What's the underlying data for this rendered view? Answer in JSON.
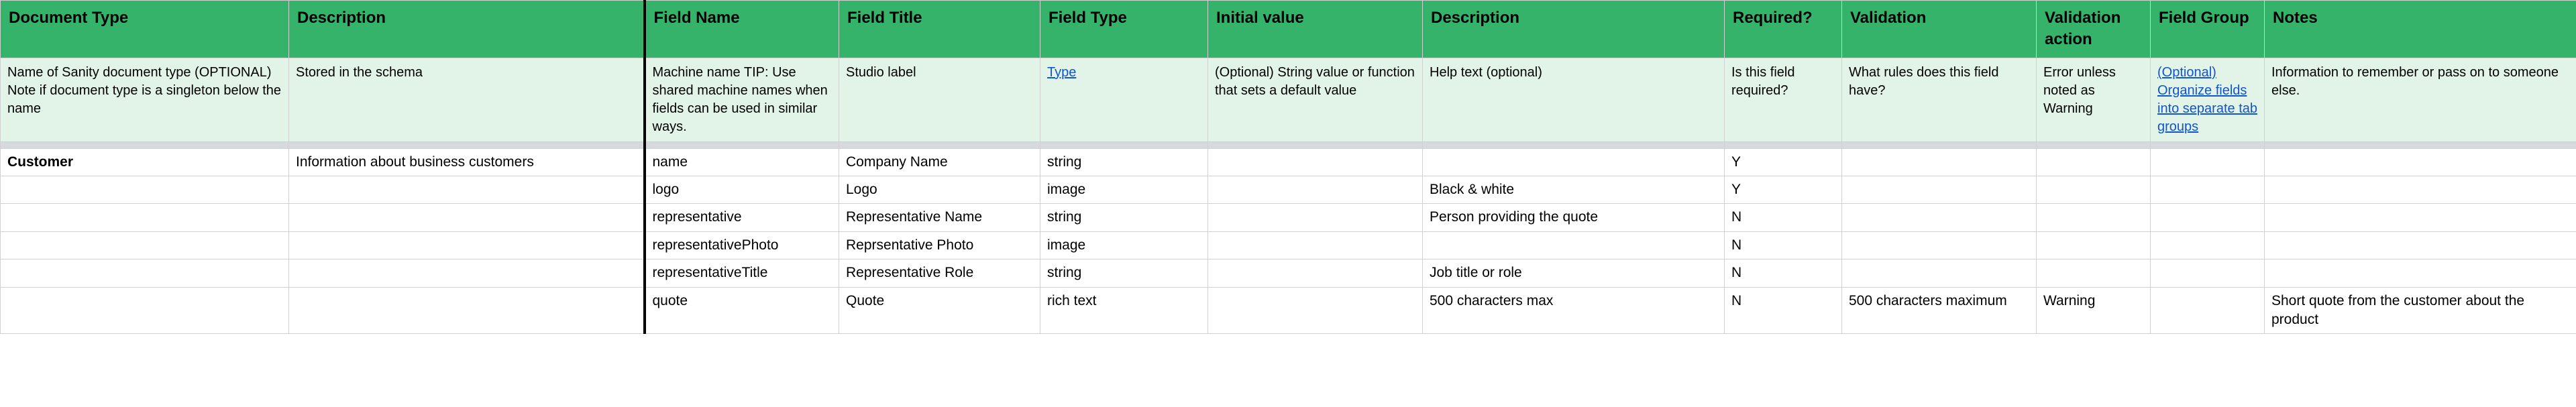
{
  "headers": [
    "Document Type",
    "Description",
    "Field Name",
    "Field Title",
    "Field Type",
    "Initial value",
    "Description",
    "Required?",
    "Validation",
    "Validation action",
    "Field Group",
    "Notes"
  ],
  "desc_row": {
    "doc_type": "Name of Sanity document type (OPTIONAL) Note if document type is a singleton below the name",
    "description": "Stored in the schema",
    "field_name": "Machine name\nTIP: Use shared machine names when fields can be used in similar ways.",
    "field_title": "Studio label",
    "field_type_link": "Type",
    "initial_value": "(Optional) String value or function that sets a default value",
    "field_desc": "Help text (optional)",
    "required": "Is this field required?",
    "validation": "What rules does this field have?",
    "validation_action": "Error unless noted as Warning",
    "field_group_link": "(Optional) Organize fields into separate tab groups",
    "notes": "Information to remember or pass on to someone else."
  },
  "rows": [
    {
      "doc_type": "Customer",
      "doc_type_bold": true,
      "description": "Information about business customers",
      "field_name": "name",
      "field_title": "Company Name",
      "field_type": "string",
      "initial_value": "",
      "field_desc": "",
      "required": "Y",
      "validation": "",
      "validation_action": "",
      "field_group": "",
      "notes": ""
    },
    {
      "doc_type": "",
      "description": "",
      "field_name": "logo",
      "field_title": "Logo",
      "field_type": "image",
      "initial_value": "",
      "field_desc": "Black & white",
      "required": "Y",
      "validation": "",
      "validation_action": "",
      "field_group": "",
      "notes": ""
    },
    {
      "doc_type": "",
      "description": "",
      "field_name": "representative",
      "field_title": "Representative Name",
      "field_type": "string",
      "initial_value": "",
      "field_desc": "Person providing the quote",
      "required": "N",
      "validation": "",
      "validation_action": "",
      "field_group": "",
      "notes": ""
    },
    {
      "doc_type": "",
      "description": "",
      "field_name": "representativePhoto",
      "field_title": "Reprsentative Photo",
      "field_type": "image",
      "initial_value": "",
      "field_desc": "",
      "required": "N",
      "validation": "",
      "validation_action": "",
      "field_group": "",
      "notes": ""
    },
    {
      "doc_type": "",
      "description": "",
      "field_name": "representativeTitle",
      "field_title": "Representative Role",
      "field_type": "string",
      "initial_value": "",
      "field_desc": "Job title or role",
      "required": "N",
      "validation": "",
      "validation_action": "",
      "field_group": "",
      "notes": ""
    },
    {
      "doc_type": "",
      "description": "",
      "field_name": "quote",
      "field_title": "Quote",
      "field_type": "rich text",
      "initial_value": "",
      "field_desc": "500 characters max",
      "required": "N",
      "validation": "500 characters maximum",
      "validation_action": "Warning",
      "field_group": "",
      "notes": "Short quote from the customer about the product"
    }
  ]
}
